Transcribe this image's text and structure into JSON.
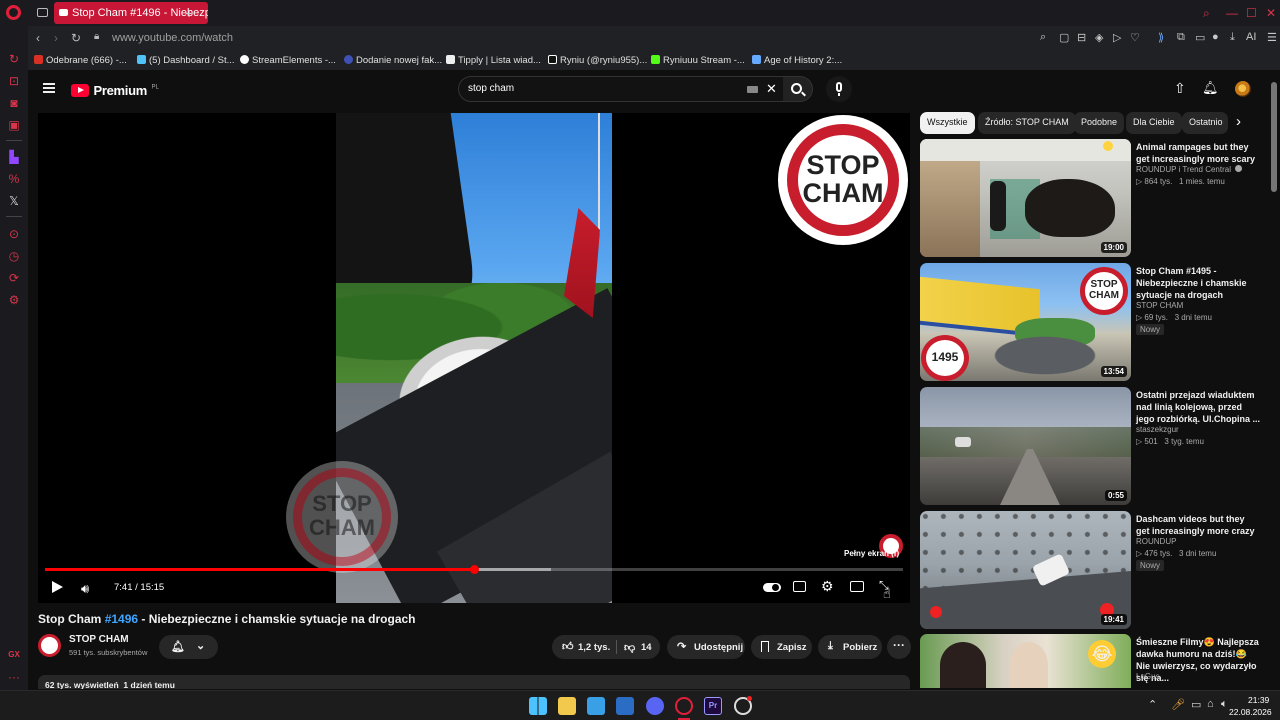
{
  "browser": {
    "tab_title": "Stop Cham #1496 - Niebezpieczne",
    "url": "www.youtube.com/watch",
    "aria_label": "AI",
    "bookmarks": [
      {
        "label": "Odebrane (666) -...",
        "color": "#d93025"
      },
      {
        "label": "(5) Dashboard / St...",
        "color": "#4fc3f7"
      },
      {
        "label": "StreamElements -...",
        "color": "#ffffff"
      },
      {
        "label": "Dodanie nowej fak...",
        "color": "#3f51b5"
      },
      {
        "label": "Tipply | Lista wiad...",
        "color": "#eeeeee"
      },
      {
        "label": "Ryniu (@ryniu955)...",
        "color": "#ffffff"
      },
      {
        "label": "Ryniuuu Stream -...",
        "color": "#53fc18"
      },
      {
        "label": "Age of History 2:...",
        "color": "#66aaff"
      }
    ]
  },
  "youtube": {
    "logo_text": "Premium",
    "logo_region": "PL",
    "search_value": "stop cham",
    "chips": [
      "Wszystkie",
      "Źródło: STOP CHAM",
      "Podobne",
      "Dla Ciebie",
      "Ostatnio"
    ]
  },
  "player": {
    "time": "7:41 / 15:15",
    "progress_fraction": 0.5,
    "buffered_fraction": 0.59,
    "tooltip": "Pełny ekran (f)",
    "watermark_line1": "STOP",
    "watermark_line2": "CHAM"
  },
  "video": {
    "title_prefix": "Stop Cham",
    "title_hashtag": "#1496",
    "title_suffix": "- Niebezpieczne i chamskie sytuacje na drogach",
    "channel_name": "STOP CHAM",
    "subscribers": "591 tys. subskrybentów",
    "likes": "1,2 tys.",
    "dislikes": "14",
    "share_label": "Udostępnij",
    "save_label": "Zapisz",
    "download_label": "Pobierz",
    "views_line": "62 tys. wyświetleń  1 dzień temu"
  },
  "recommendations": [
    {
      "title": "Animal rampages but they get increasingly more scary",
      "channel": "ROUNDUP i Trend Central",
      "meta": "▷ 864 tys.   1 mies. temu",
      "badge": "",
      "duration": "19:00"
    },
    {
      "title": "Stop Cham #1495 - Niebezpieczne i chamskie sytuacje na drogach",
      "channel": "STOP CHAM",
      "meta": "▷ 69 tys.   3 dni temu",
      "badge": "Nowy",
      "duration": "13:54",
      "thumb_number": "1495"
    },
    {
      "title": "Ostatni przejazd wiaduktem nad linią kolejową, przed  jego rozbiórką. Ul.Chopina ...",
      "channel": "staszekzgur",
      "meta": "▷ 501   3 tyg. temu",
      "badge": "",
      "duration": "0:55"
    },
    {
      "title": "Dashcam videos but they get increasingly more crazy",
      "channel": "ROUNDUP",
      "meta": "▷ 476 tys.   3 dni temu",
      "badge": "Nowy",
      "duration": "19:41"
    },
    {
      "title": "Śmieszne Filmy😍 Najlepsza dawka humoru na dziś!😂 Nie uwierzysz, co wydarzyło się na...",
      "channel": "ŁuGus",
      "meta": "",
      "badge": "",
      "duration": ""
    }
  ],
  "taskbar": {
    "time": "21:39",
    "date": "22.08.2026"
  }
}
